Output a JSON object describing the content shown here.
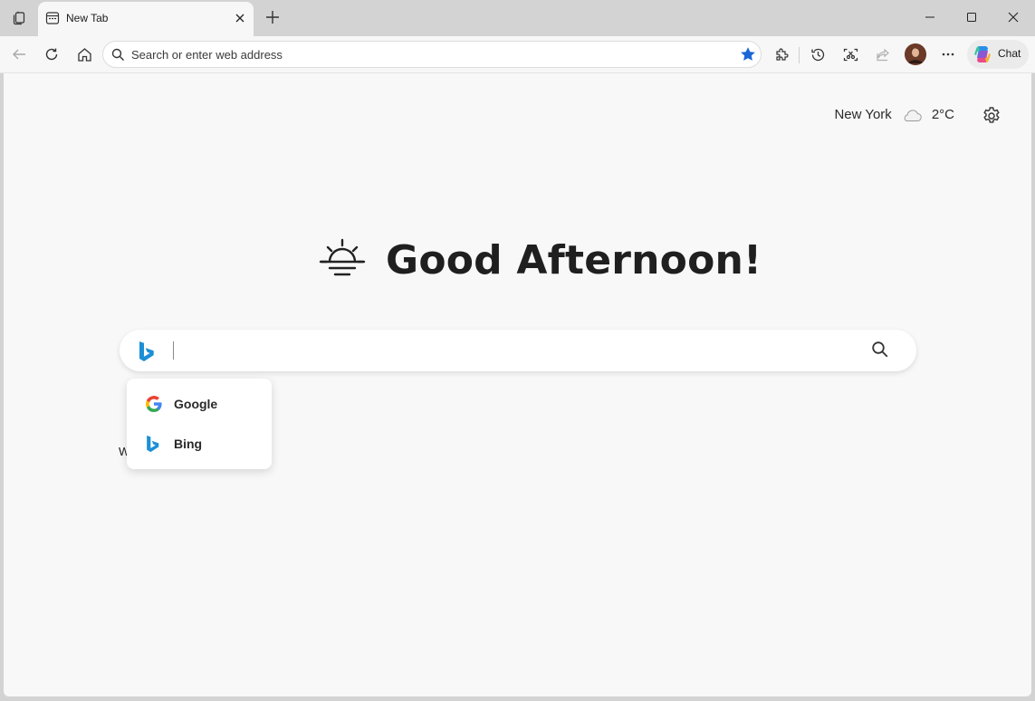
{
  "browser": {
    "tab": {
      "title": "New Tab"
    },
    "address_bar": {
      "placeholder": "Search or enter web address",
      "value": ""
    },
    "chat": {
      "label": "Chat"
    }
  },
  "weather": {
    "city": "New York",
    "temperature": "2°C",
    "condition_icon": "cloud-icon"
  },
  "greeting": {
    "text": "Good Afternoon!",
    "icon": "sunrise-icon"
  },
  "search": {
    "engine_icon": "bing-logo-icon",
    "value": "",
    "engines": [
      {
        "label": "Google",
        "icon": "google-logo-icon"
      },
      {
        "label": "Bing",
        "icon": "bing-logo-icon"
      }
    ]
  },
  "partial_text": "W",
  "colors": {
    "accent_star": "#1a66d6",
    "bing_blue": "#1b8fd6"
  }
}
